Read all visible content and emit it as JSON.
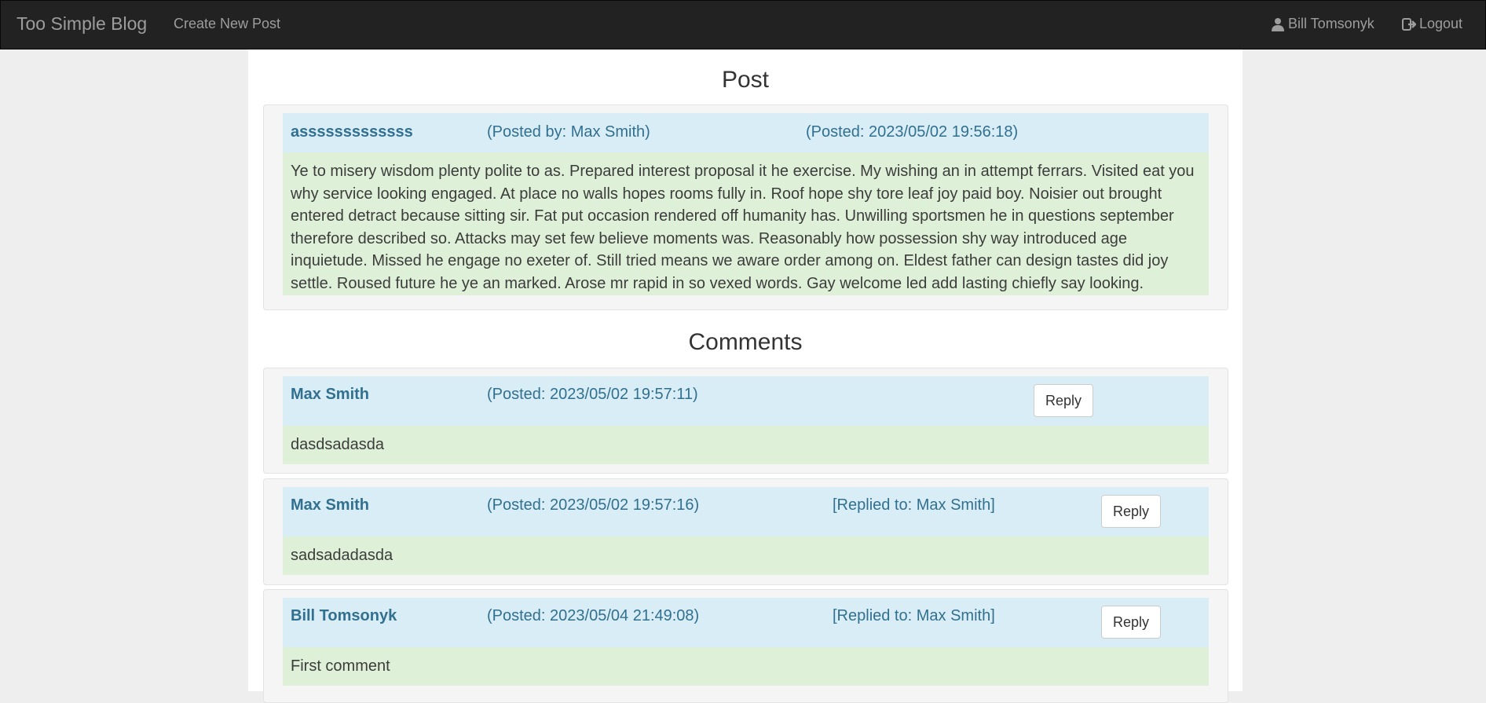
{
  "navbar": {
    "brand": "Too Simple Blog",
    "create_link": "Create New Post",
    "user_name": "Bill Tomsonyk",
    "logout_label": "Logout",
    "user_icon": "user-icon",
    "logout_icon": "logout-icon"
  },
  "post_section": {
    "heading": "Post",
    "title": "asssssssssssss",
    "posted_by": "(Posted by: Max Smith)",
    "posted_at": "(Posted: 2023/05/02 19:56:18)",
    "body": "Ye to misery wisdom plenty polite to as. Prepared interest proposal it he exercise. My wishing an in attempt ferrars. Visited eat you why service looking engaged. At place no walls hopes rooms fully in. Roof hope shy tore leaf joy paid boy. Noisier out brought entered detract because sitting sir. Fat put occasion rendered off humanity has. Unwilling sportsmen he in questions september therefore described so. Attacks may set few believe moments was. Reasonably how possession shy way introduced age inquietude. Missed he engage no exeter of. Still tried means we aware order among on. Eldest father can design tastes did joy settle. Roused future he ye an marked. Arose mr rapid in so vexed words. Gay welcome led add lasting chiefly say looking."
  },
  "comments_section": {
    "heading": "Comments",
    "reply_label": "Reply",
    "comments": [
      {
        "author": "Max Smith",
        "posted_at": "(Posted: 2023/05/02 19:57:11)",
        "replied_to": "",
        "text": "dasdsadasda"
      },
      {
        "author": "Max Smith",
        "posted_at": "(Posted: 2023/05/02 19:57:16)",
        "replied_to": "[Replied to: Max Smith]",
        "text": "sadsadadasda"
      },
      {
        "author": "Bill Tomsonyk",
        "posted_at": "(Posted: 2023/05/04 21:49:08)",
        "replied_to": "[Replied to: Max Smith]",
        "text": "First comment"
      }
    ]
  },
  "colors": {
    "navbar_bg": "#222222",
    "header_bg": "#d9edf7",
    "body_bg": "#dff0d8",
    "header_text": "#31708f"
  }
}
